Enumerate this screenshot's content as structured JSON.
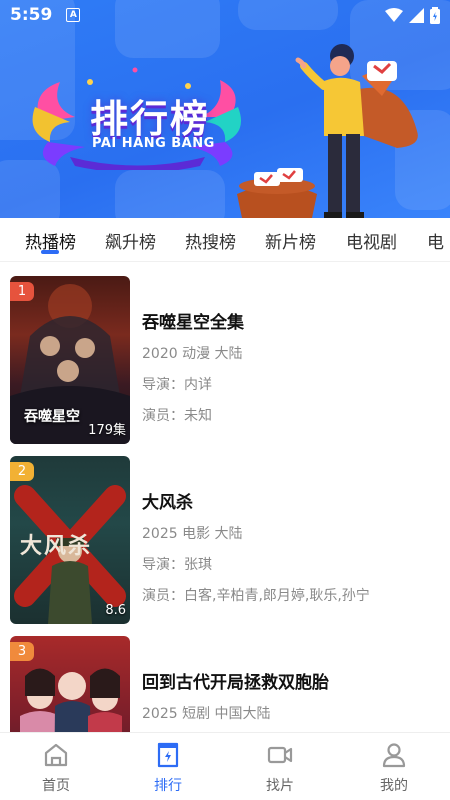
{
  "status": {
    "time": "5:59",
    "notif_icon": "A"
  },
  "banner": {
    "title": "排行榜",
    "subtitle": "PAI HANG BANG"
  },
  "tabs": [
    {
      "label": "热播榜",
      "active": true
    },
    {
      "label": "飙升榜",
      "active": false
    },
    {
      "label": "热搜榜",
      "active": false
    },
    {
      "label": "新片榜",
      "active": false
    },
    {
      "label": "电视剧",
      "active": false
    },
    {
      "label": "电",
      "active": false
    }
  ],
  "items": [
    {
      "rank": "1",
      "rank_color": "#e6533d",
      "poster_text": "吞噬星空",
      "episode": "179集",
      "title": "吞噬星空全集",
      "info": "2020 动漫 大陆",
      "director": "导演：内详",
      "cast": "演员：未知"
    },
    {
      "rank": "2",
      "rank_color": "#f2b134",
      "poster_text": "大风杀",
      "episode": "8.6",
      "title": "大风杀",
      "info": "2025 电影 大陆",
      "director": "导演：张琪",
      "cast": "演员：白客,辛柏青,郎月婷,耿乐,孙宁"
    },
    {
      "rank": "3",
      "rank_color": "#f08a3c",
      "poster_text": "",
      "episode": "",
      "title": "回到古代开局拯救双胞胎",
      "info": "2025 短剧 中国大陆",
      "director": "",
      "cast": ""
    }
  ],
  "nav": [
    {
      "label": "首页",
      "icon": "home-icon",
      "active": false
    },
    {
      "label": "排行",
      "icon": "ranking-icon",
      "active": true
    },
    {
      "label": "找片",
      "icon": "video-icon",
      "active": false
    },
    {
      "label": "我的",
      "icon": "user-icon",
      "active": false
    }
  ],
  "colors": {
    "accent": "#2d6cf5",
    "banner": "#2f7cf6"
  }
}
